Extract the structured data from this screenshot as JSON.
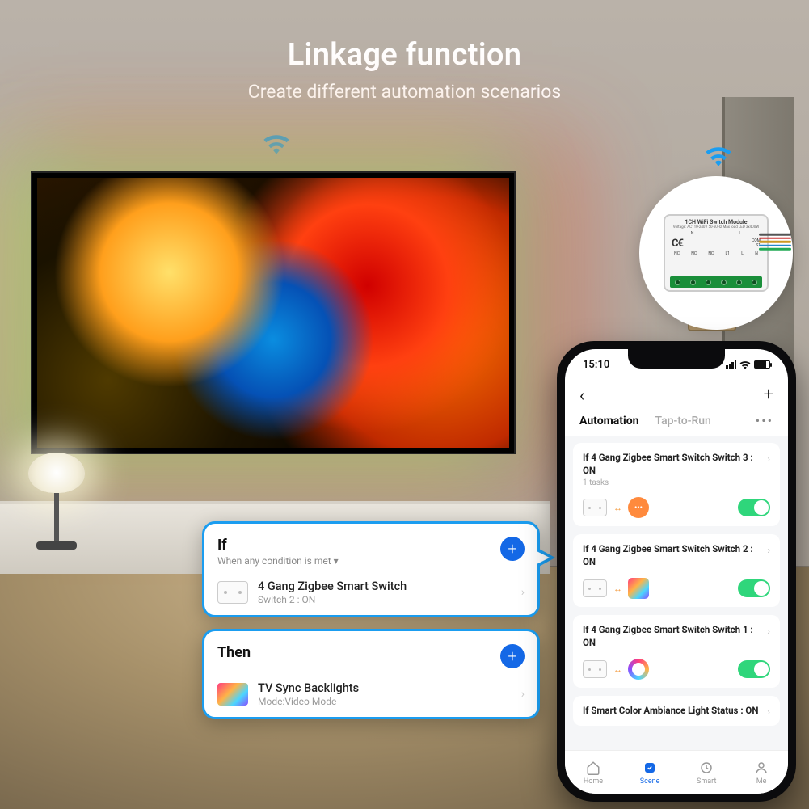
{
  "header": {
    "title": "Linkage function",
    "subtitle": "Create different automation scenarios"
  },
  "module": {
    "title": "1CH WiFi Switch Module",
    "spec": "Voltage: AC110-240V 50-60Hz  Max load LED 3x400W",
    "ce": "C€",
    "pins_top": [
      "N",
      "L"
    ],
    "pins_bot": [
      "NC",
      "NC",
      "NC",
      "L1",
      "L",
      "N"
    ],
    "side": [
      "COM",
      "S1"
    ]
  },
  "popup": {
    "if": {
      "heading": "If",
      "subtitle": "When any condition is met",
      "device": "4 Gang Zigbee Smart Switch",
      "state": "Switch 2 : ON"
    },
    "then": {
      "heading": "Then",
      "device": "TV Sync Backlights",
      "state": "Mode:Video Mode"
    }
  },
  "phone": {
    "time": "15:10",
    "tabs": {
      "automation": "Automation",
      "tap": "Tap-to-Run"
    },
    "items": [
      {
        "title": "If 4 Gang Zigbee Smart Switch Switch 3 : ON",
        "subtitle": "1 tasks",
        "target": "chat"
      },
      {
        "title": "If 4 Gang Zigbee Smart Switch Switch 2 : ON",
        "subtitle": "",
        "target": "rgb"
      },
      {
        "title": "If 4 Gang Zigbee Smart Switch Switch 1 : ON",
        "subtitle": "",
        "target": "ring"
      },
      {
        "title": "If Smart Color Ambiance Light  Status : ON",
        "subtitle": "",
        "target": ""
      }
    ],
    "nav": {
      "home": "Home",
      "scene": "Scene",
      "smart": "Smart",
      "me": "Me"
    }
  }
}
